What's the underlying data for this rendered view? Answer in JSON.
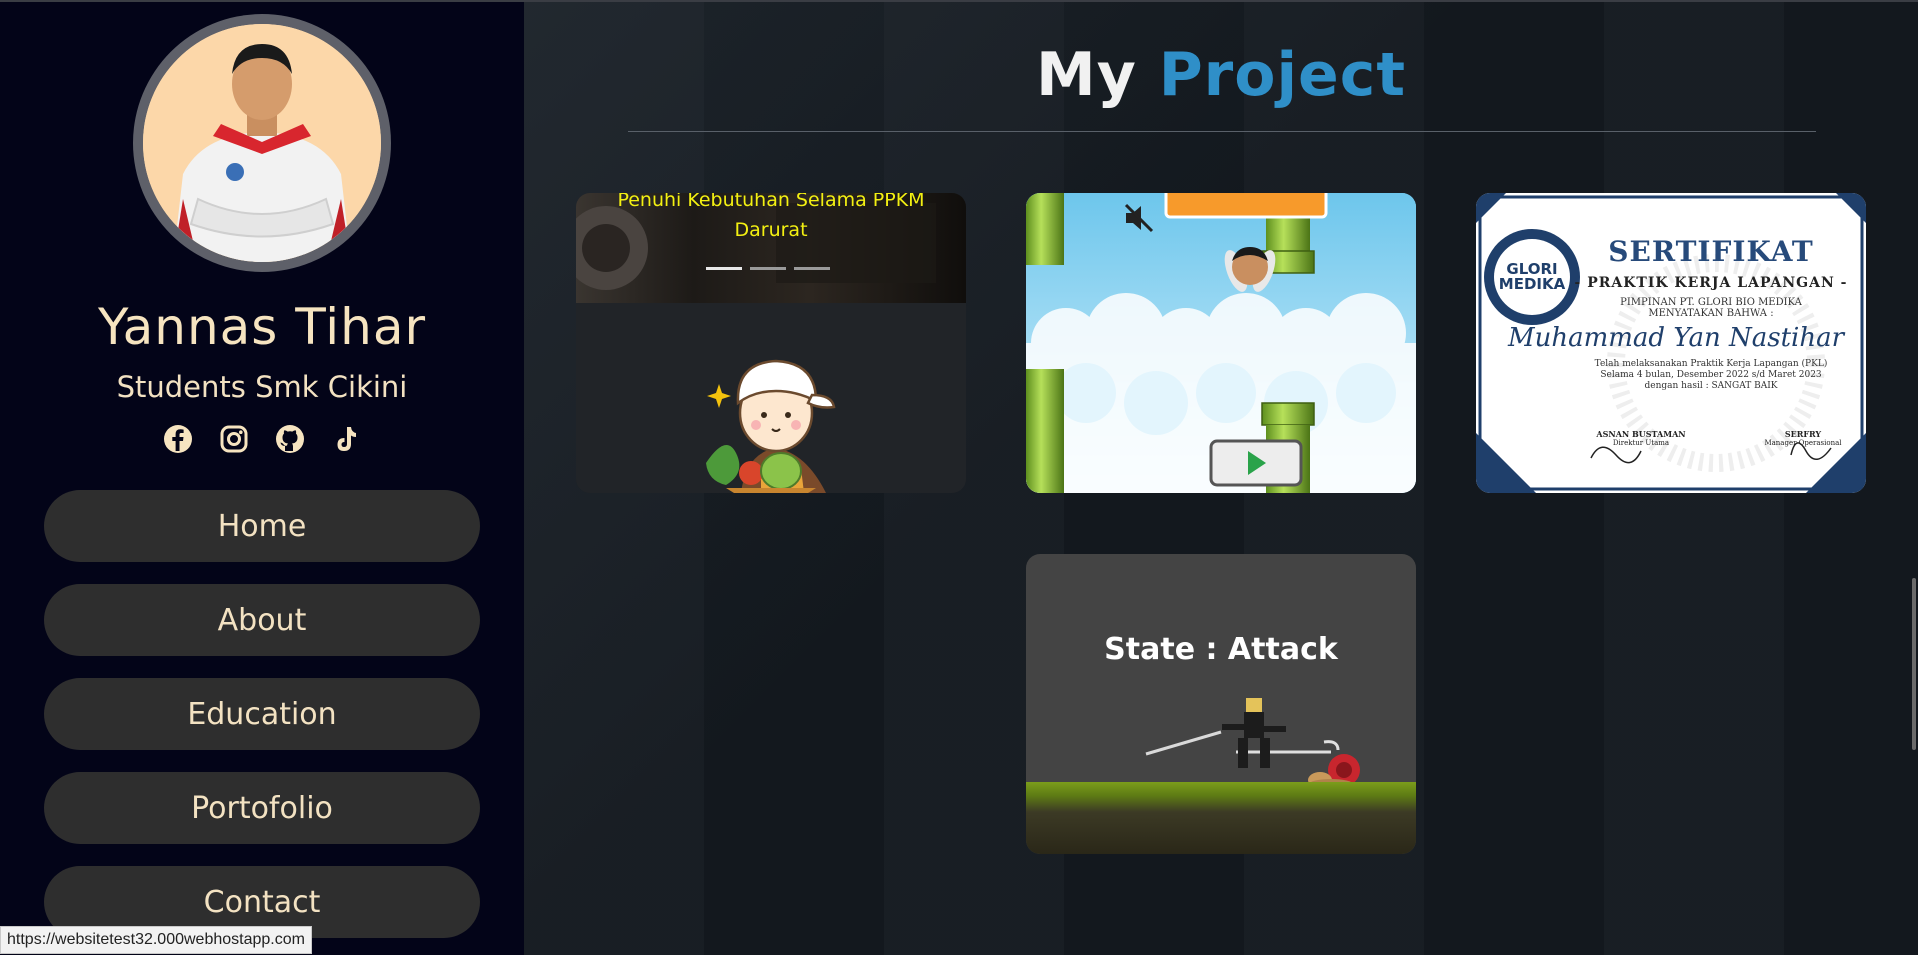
{
  "profile": {
    "name": "Yannas Tihar",
    "role": "Students Smk Cikini"
  },
  "socials": [
    {
      "icon": "facebook-icon"
    },
    {
      "icon": "instagram-icon"
    },
    {
      "icon": "github-icon"
    },
    {
      "icon": "tiktok-icon"
    }
  ],
  "nav": {
    "home": "Home",
    "about": "About",
    "education": "Education",
    "portfolio": "Portofolio",
    "contact": "Contact"
  },
  "main": {
    "title_part1": "My",
    "title_part2": "Project"
  },
  "projects": {
    "card1": {
      "caption_line1": "Penuhi Kebutuhan Selama PPKM",
      "caption_line2": "Darurat"
    },
    "card3": {
      "logo": "GLORI MEDIKA",
      "title": "SERTIFIKAT",
      "subtitle": "- PRAKTIK KERJA LAPANGAN -",
      "line1": "PIMPINAN PT. GLORI BIO MEDIKA",
      "line2": "MENYATAKAN BAHWA :",
      "recipient": "Muhammad Yan Nastihar",
      "body1": "Telah melaksanakan Praktik Kerja Lapangan (PKL)",
      "body2": "Selama 4 bulan, Desember 2022 s/d Maret 2023",
      "body3": "dengan hasil : SANGAT BAIK",
      "sig1_name": "ASNAN BUSTAMAN",
      "sig1_role": "Direktur Utama",
      "sig2_name": "SERFRY",
      "sig2_role": "Manager Operasional"
    },
    "card4": {
      "state_text": "State : Attack"
    }
  },
  "status_bar": {
    "url": "https://websitetest32.000webhostapp.com"
  },
  "colors": {
    "sidebar_bg": "#030418",
    "accent": "#2f8fc8",
    "cream": "#f6e4c0",
    "nav_btn": "#2e2e2e"
  }
}
